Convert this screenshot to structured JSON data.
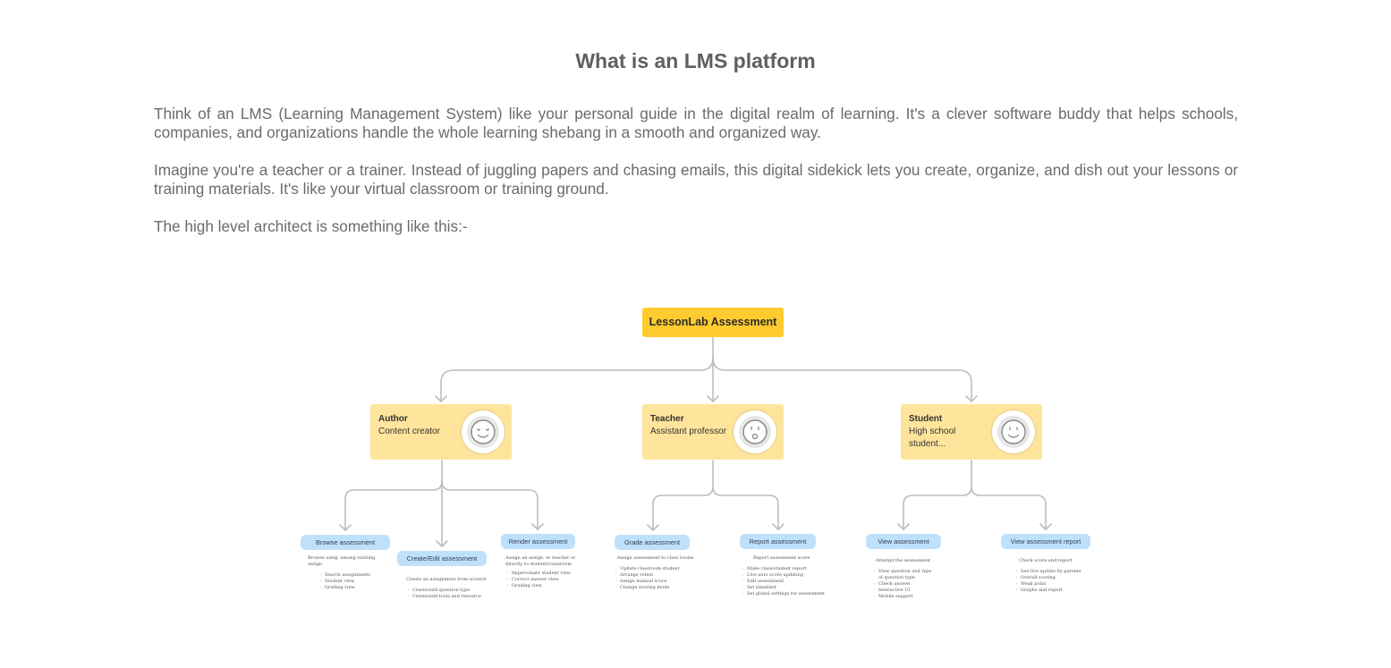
{
  "heading": "What is an LMS platform",
  "paragraphs": [
    "Think of an LMS (Learning Management System) like your personal guide in the digital realm of learning. It's a clever software buddy that helps schools, companies, and organizations handle the whole learning shebang in a smooth and organized way.",
    "Imagine you're a teacher or a trainer. Instead of juggling papers and chasing emails, this digital sidekick lets you create, organize, and dish out your lessons or training materials. It's like your virtual classroom or training ground.",
    "The high level architect is something like this:-"
  ],
  "diagram": {
    "colors": {
      "root": "#ffcb2f",
      "role": "#ffe49b",
      "pill": "#bfe0fb",
      "connector": "#bdbdbd"
    },
    "root": "LessonLab Assessment",
    "roles": [
      {
        "name": "Author",
        "desc": "Content creator",
        "icon": "smile-face-icon"
      },
      {
        "name": "Teacher",
        "desc": "Assistant professor",
        "icon": "surprised-face-icon"
      },
      {
        "name": "Student",
        "desc": "High school student...",
        "icon": "smile-face-icon"
      }
    ],
    "actions": [
      {
        "label": "Browse assessment",
        "desc": "Browse assig. among existing assign",
        "items": [
          "Search assignments",
          "Student view",
          "Grading view"
        ]
      },
      {
        "label": "Create/Edit assessment",
        "desc": "Create an assignment from scratch",
        "items": [
          "Create/add question type",
          "Create/add tools and resource"
        ]
      },
      {
        "label": "Render assessment",
        "desc": "Assign an assign. to teacher or directly to student/classroom",
        "items": [
          "Impersonate student view",
          "Correct answer view",
          "Grading view"
        ]
      },
      {
        "label": "Grade assessment",
        "desc": "Assign assessment to class rooms",
        "items": [
          "Update classroom student",
          "Arrange retest",
          "Assign manual score",
          "Change scoring mode"
        ]
      },
      {
        "label": "Report assessment",
        "desc": "Report assessment score",
        "items": [
          "Make class/student report",
          "Live auto score updating",
          "Edit assessment",
          "Set timelimit",
          "Set global settings for assessment"
        ]
      },
      {
        "label": "View assessment",
        "desc": "Attempt the assessment",
        "items": [
          "View question and type of question type",
          "Check answer",
          "Interactive UI",
          "Mobile support"
        ]
      },
      {
        "label": "View assessment report",
        "desc": "Check score and report",
        "items": [
          "See live update by parents",
          "Overall scoring",
          "Weak point",
          "Graphs and report"
        ]
      }
    ]
  }
}
